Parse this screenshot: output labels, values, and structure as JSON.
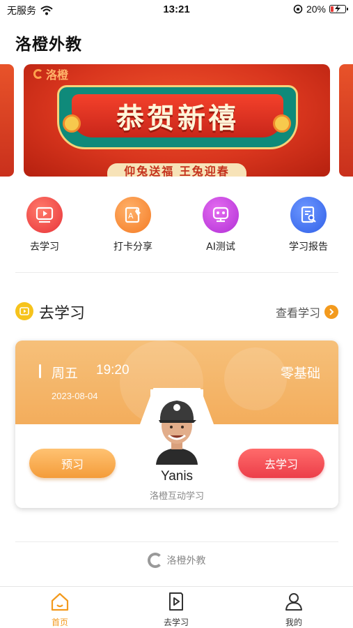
{
  "status_bar": {
    "carrier": "无服务",
    "time": "13:21",
    "battery_percent": "20%",
    "battery_level": 0.2
  },
  "header": {
    "title": "洛橙外教"
  },
  "banner": {
    "brand": "洛橙",
    "headline": "恭贺新禧",
    "subline": "仰兔送福 王兔迎春"
  },
  "quick_nav": [
    {
      "label": "去学习",
      "icon": "play-icon",
      "color": "#f0453f"
    },
    {
      "label": "打卡分享",
      "icon": "edit-card-icon",
      "color": "#f7882f"
    },
    {
      "label": "AI测试",
      "icon": "robot-icon",
      "color": "#c13de0"
    },
    {
      "label": "学习报告",
      "icon": "report-icon",
      "color": "#3b6ef0"
    }
  ],
  "section": {
    "title": "去学习",
    "more_label": "查看学习"
  },
  "lesson": {
    "day": "周五",
    "time": "19:20",
    "level": "零基础",
    "date": "2023-08-04",
    "preview_label": "预习",
    "study_label": "去学习",
    "teacher_name": "Yanis",
    "teacher_org": "洛橙互动学习"
  },
  "footer": {
    "brand": "洛橙外教"
  },
  "tab_bar": [
    {
      "label": "首页",
      "icon": "home-icon",
      "active": true
    },
    {
      "label": "去学习",
      "icon": "book-play-icon",
      "active": false
    },
    {
      "label": "我的",
      "icon": "user-icon",
      "active": false
    }
  ],
  "colors": {
    "accent": "#f39a1d",
    "study_red": "#ec3e49",
    "preview_orange": "#f49c3a"
  }
}
